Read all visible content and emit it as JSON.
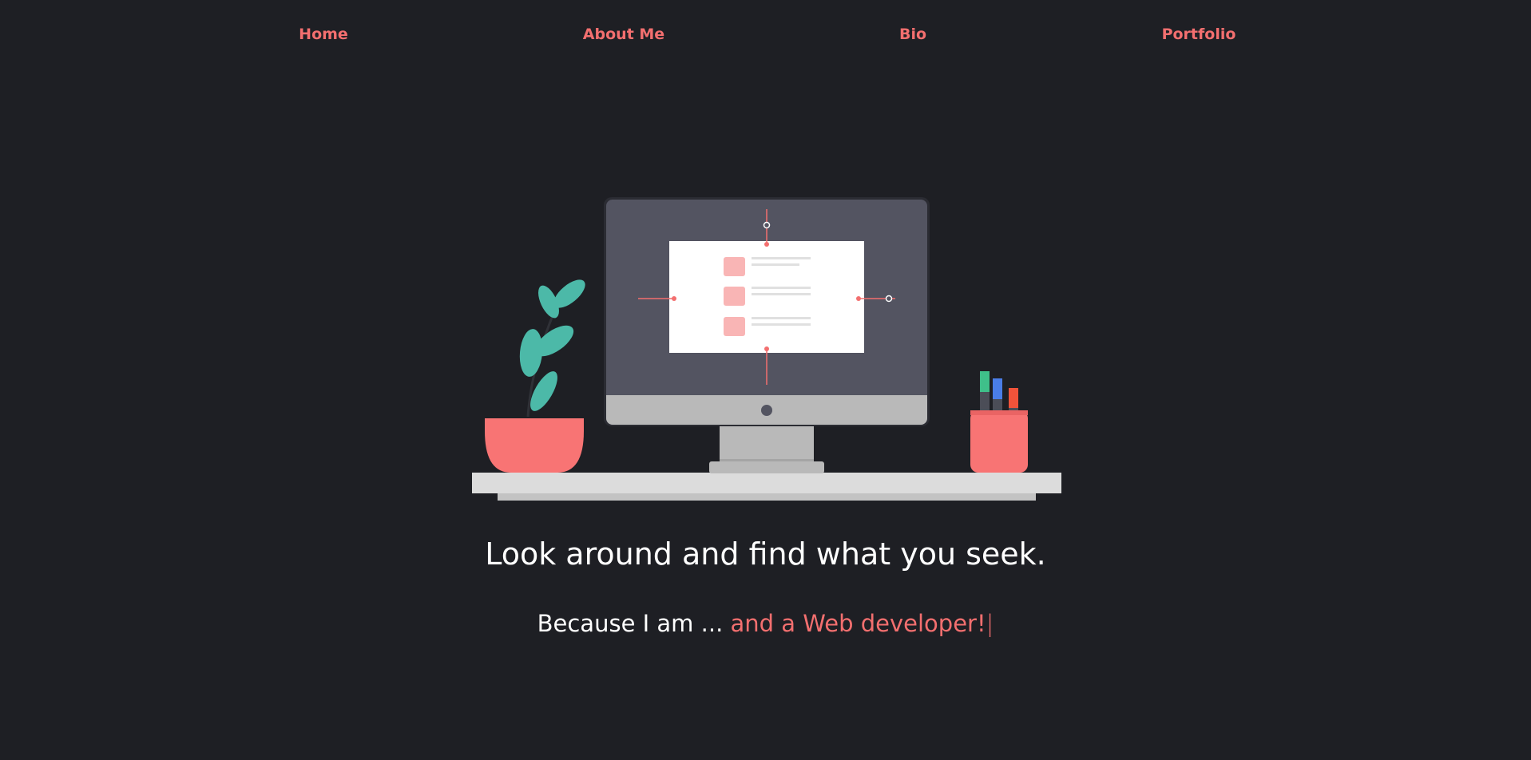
{
  "nav": {
    "items": [
      {
        "label": "Home"
      },
      {
        "label": "About Me"
      },
      {
        "label": "Bio"
      },
      {
        "label": "Portfolio"
      }
    ]
  },
  "hero": {
    "headline": "Look around and find what you seek.",
    "subline_lead": "Because I am ...",
    "subline_typed": "and a Web developer!",
    "cursor": "|"
  },
  "theme": {
    "background": "#1e1f24",
    "accent": "#f36f6f",
    "text": "#ffffff"
  },
  "illustration": {
    "icons": [
      "plant-icon",
      "monitor-icon",
      "pencil-cup-icon",
      "desk-icon"
    ]
  }
}
